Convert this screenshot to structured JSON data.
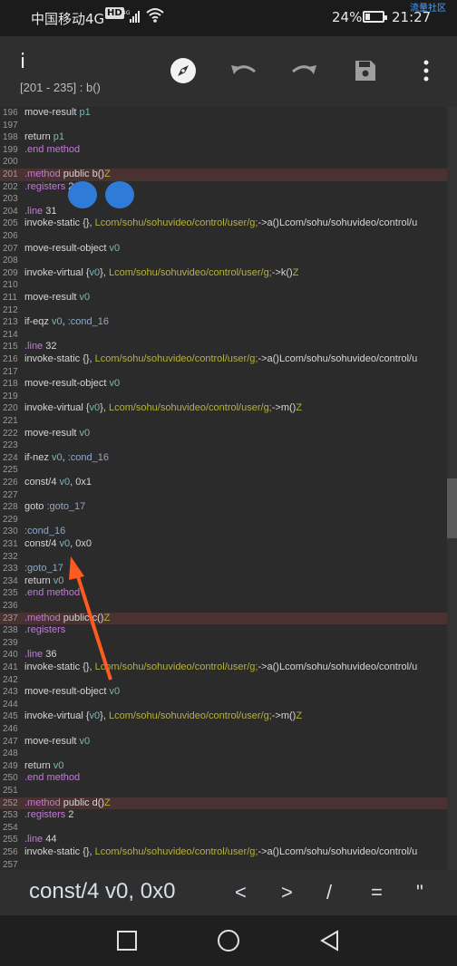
{
  "status_bar": {
    "carrier": "中国移动4G",
    "network_badge": "HD",
    "signal_label": "4G",
    "battery_percent_text": "24%",
    "battery_level": 0.24,
    "time": "21:27",
    "corner_text": "流量社区"
  },
  "toolbar": {
    "title": "i",
    "subtitle": "[201 - 235] : b()",
    "icons": [
      "compass-icon",
      "undo-icon",
      "redo-icon",
      "save-icon",
      "more-vert-icon"
    ]
  },
  "editor": {
    "lines": [
      {
        "n": "196",
        "t": "    move-result  p1"
      },
      {
        "n": "197",
        "t": ""
      },
      {
        "n": "198",
        "t": "    return  p1"
      },
      {
        "n": "199",
        "t": ".end method"
      },
      {
        "n": "200",
        "t": ""
      },
      {
        "n": "201",
        "t": ".method public b()Z",
        "hl": true
      },
      {
        "n": "202",
        "t": "    .registers 2"
      },
      {
        "n": "203",
        "t": ""
      },
      {
        "n": "204",
        "t": "    .line  31"
      },
      {
        "n": "205",
        "t": "    invoke-static  {}, Lcom/sohu/sohuvideo/control/user/g;->a()Lcom/sohu/sohuvideo/control/u"
      },
      {
        "n": "206",
        "t": ""
      },
      {
        "n": "207",
        "t": "    move-result-object  v0"
      },
      {
        "n": "208",
        "t": ""
      },
      {
        "n": "209",
        "t": "    invoke-virtual  {v0}, Lcom/sohu/sohuvideo/control/user/g;->k()Z"
      },
      {
        "n": "210",
        "t": ""
      },
      {
        "n": "211",
        "t": "    move-result  v0"
      },
      {
        "n": "212",
        "t": ""
      },
      {
        "n": "213",
        "t": "    if-eqz  v0, :cond_16"
      },
      {
        "n": "214",
        "t": ""
      },
      {
        "n": "215",
        "t": "    .line  32"
      },
      {
        "n": "216",
        "t": "    invoke-static  {}, Lcom/sohu/sohuvideo/control/user/g;->a()Lcom/sohu/sohuvideo/control/u"
      },
      {
        "n": "217",
        "t": ""
      },
      {
        "n": "218",
        "t": "    move-result-object  v0"
      },
      {
        "n": "219",
        "t": ""
      },
      {
        "n": "220",
        "t": "    invoke-virtual  {v0}, Lcom/sohu/sohuvideo/control/user/g;->m()Z"
      },
      {
        "n": "221",
        "t": ""
      },
      {
        "n": "222",
        "t": "    move-result  v0"
      },
      {
        "n": "223",
        "t": ""
      },
      {
        "n": "224",
        "t": "    if-nez  v0, :cond_16"
      },
      {
        "n": "225",
        "t": ""
      },
      {
        "n": "226",
        "t": "    const/4  v0, 0x1"
      },
      {
        "n": "227",
        "t": ""
      },
      {
        "n": "228",
        "t": "    goto  :goto_17"
      },
      {
        "n": "229",
        "t": ""
      },
      {
        "n": "230",
        "t": "    :cond_16"
      },
      {
        "n": "231",
        "t": "    const/4  v0, 0x0"
      },
      {
        "n": "232",
        "t": ""
      },
      {
        "n": "233",
        "t": "    :goto_17"
      },
      {
        "n": "234",
        "t": "    return  v0"
      },
      {
        "n": "235",
        "t": ".end method"
      },
      {
        "n": "236",
        "t": ""
      },
      {
        "n": "237",
        "t": ".method public c()Z",
        "hl": true
      },
      {
        "n": "238",
        "t": "    .registers"
      },
      {
        "n": "239",
        "t": ""
      },
      {
        "n": "240",
        "t": "    .line  36"
      },
      {
        "n": "241",
        "t": "    invoke-static  {}, Lcom/sohu/sohuvideo/control/user/g;->a()Lcom/sohu/sohuvideo/control/u"
      },
      {
        "n": "242",
        "t": ""
      },
      {
        "n": "243",
        "t": "    move-result-object  v0"
      },
      {
        "n": "244",
        "t": ""
      },
      {
        "n": "245",
        "t": "    invoke-virtual  {v0}, Lcom/sohu/sohuvideo/control/user/g;->m()Z"
      },
      {
        "n": "246",
        "t": ""
      },
      {
        "n": "247",
        "t": "    move-result  v0"
      },
      {
        "n": "248",
        "t": ""
      },
      {
        "n": "249",
        "t": "    return  v0"
      },
      {
        "n": "250",
        "t": ".end method"
      },
      {
        "n": "251",
        "t": ""
      },
      {
        "n": "252",
        "t": ".method public d()Z",
        "hl": true
      },
      {
        "n": "253",
        "t": "    .registers  2"
      },
      {
        "n": "254",
        "t": ""
      },
      {
        "n": "255",
        "t": "    .line  44"
      },
      {
        "n": "256",
        "t": "    invoke-static  {}, Lcom/sohu/sohuvideo/control/user/g;->a()Lcom/sohu/sohuvideo/control/u"
      },
      {
        "n": "257",
        "t": ""
      }
    ]
  },
  "symbol_bar": {
    "main": "const/4 v0, 0x0",
    "symbols": [
      "<",
      ">",
      "/",
      "=",
      "\""
    ]
  },
  "colors": {
    "keyword": "#c678dd",
    "directive": "#8fa8c8",
    "string_class": "#b5b23a",
    "register": "#7fb5b5",
    "plain": "#d6d6d6",
    "highlight_line": "#4a3232",
    "arrow": "#ff5a1f"
  }
}
